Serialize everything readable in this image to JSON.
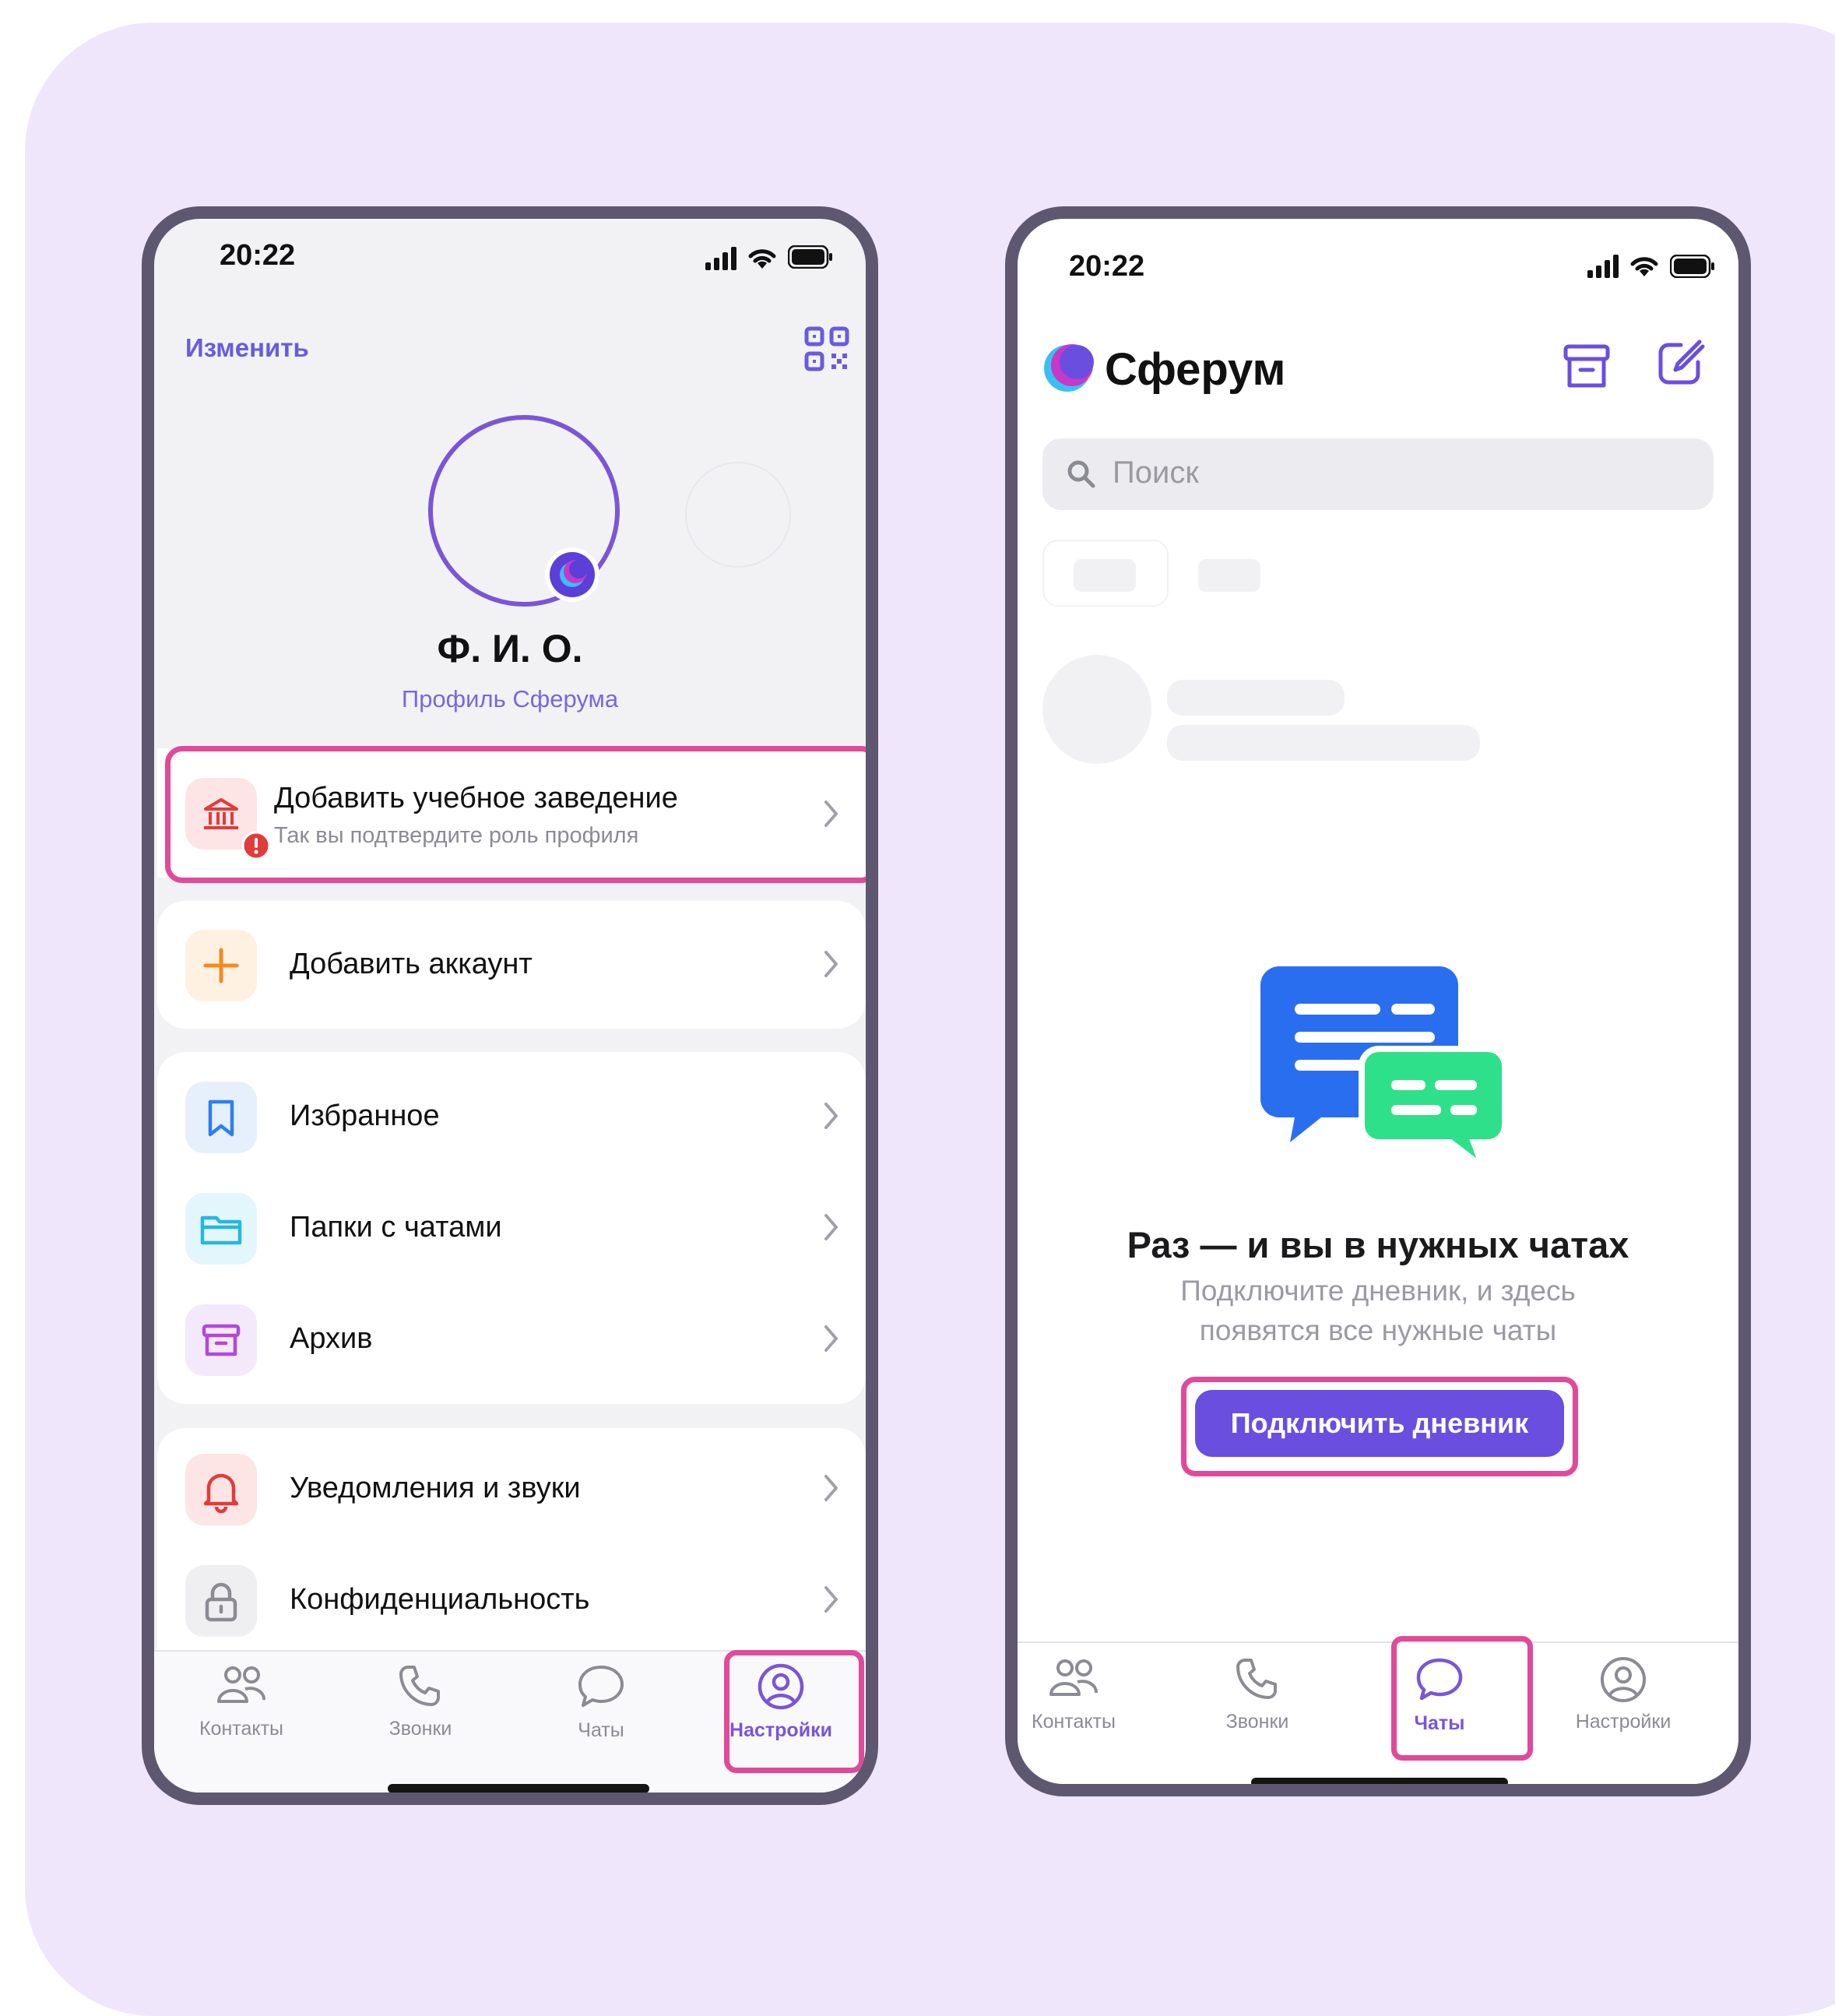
{
  "left_screen": {
    "status_time": "20:22",
    "edit_link": "Изменить",
    "profile": {
      "name": "Ф. И. О.",
      "subtitle": "Профиль Сферума"
    },
    "add_school": {
      "title": "Добавить учебное заведение",
      "subtitle": "Так вы подтвердите роль профиля"
    },
    "menu": {
      "add_account": "Добавить аккаунт",
      "favorites": "Избранное",
      "chat_folders": "Папки с чатами",
      "archive": "Архив",
      "notifications": "Уведомления и звуки",
      "privacy": "Конфиденциальность"
    },
    "tabs": [
      "Контакты",
      "Звонки",
      "Чаты",
      "Настройки"
    ],
    "active_tab": "Настройки"
  },
  "right_screen": {
    "status_time": "20:22",
    "app_title": "Сферум",
    "search_placeholder": "Поиск",
    "empty_state": {
      "title": "Раз — и вы в нужных чатах",
      "line1": "Подключите дневник, и здесь",
      "line2": "появятся все нужные чаты",
      "button": "Подключить дневник"
    },
    "tabs": [
      "Контакты",
      "Звонки",
      "Чаты",
      "Настройки"
    ],
    "active_tab": "Чаты"
  },
  "colors": {
    "background_card": "#f0e6fc",
    "phone_frame": "#5d5770",
    "accent": "#6a4ee0",
    "highlight": "#e1499a"
  }
}
